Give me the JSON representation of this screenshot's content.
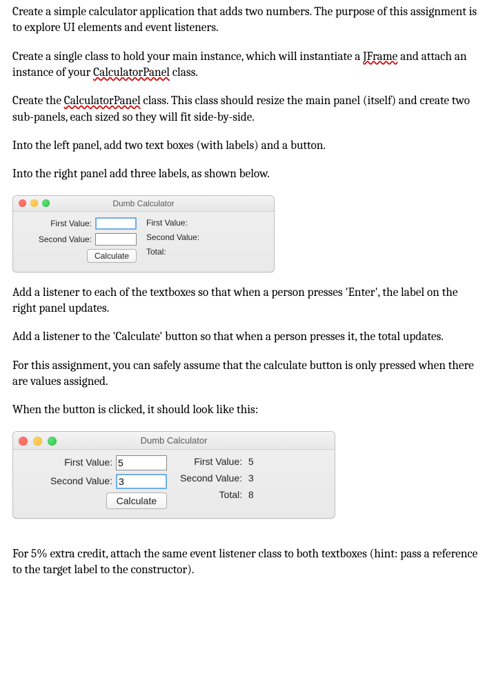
{
  "paragraphs": {
    "p1": "Create a simple calculator application that adds two numbers. The purpose of this assignment is to explore UI elements and event listeners.",
    "p2a": "Create a single class to hold your main instance, which will instantiate a ",
    "p2_squig1": "JFrame",
    "p2b": " and attach an instance of your ",
    "p2_squig2": "CalculatorPanel",
    "p2c": " class.",
    "p3a": "Create the ",
    "p3_squig1": "CalculatorPanel",
    "p3b": " class. This class should resize the main panel (itself) and create two sub-panels, each sized so they will fit side-by-side.",
    "p4": "Into the left panel, add two text boxes (with labels) and a button.",
    "p5": "Into the right panel add three labels, as shown below.",
    "p6": "Add a listener to each of the textboxes so that when a person presses 'Enter', the label on the right panel updates.",
    "p7": "Add a listener to the 'Calculate' button so that when a person presses it, the total updates.",
    "p8": "For this assignment, you can safely assume that the calculate button is only pressed when there are values assigned.",
    "p9": "When the button is clicked, it should look like this:",
    "p10": "For 5% extra credit, attach the same event listener class to both textboxes (hint: pass a reference to the target label to the constructor)."
  },
  "calc1": {
    "title": "Dumb Calculator",
    "left": {
      "first_label": "First Value:",
      "first_value": "",
      "second_label": "Second Value:",
      "second_value": "",
      "button": "Calculate"
    },
    "right": {
      "first_label": "First Value:",
      "first_value": "",
      "second_label": "Second Value:",
      "second_value": "",
      "total_label": "Total:",
      "total_value": ""
    }
  },
  "calc2": {
    "title": "Dumb Calculator",
    "left": {
      "first_label": "First Value:",
      "first_value": "5",
      "second_label": "Second Value:",
      "second_value": "3",
      "button": "Calculate"
    },
    "right": {
      "first_label": "First Value:",
      "first_value": "5",
      "second_label": "Second Value:",
      "second_value": "3",
      "total_label": "Total:",
      "total_value": "8"
    }
  }
}
